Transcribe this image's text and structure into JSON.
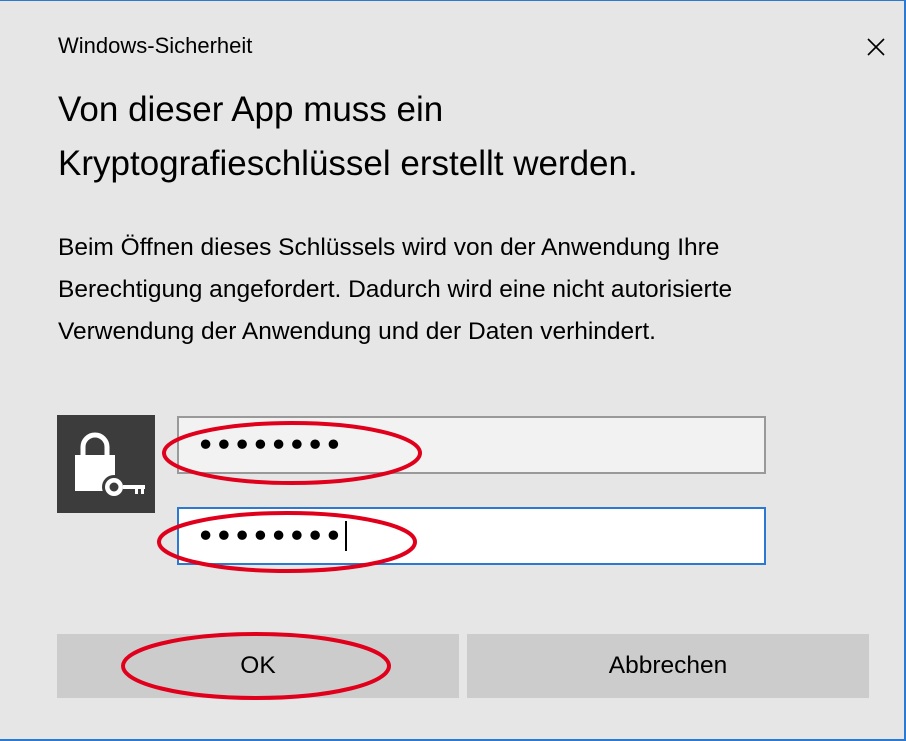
{
  "dialog": {
    "title": "Windows-Sicherheit",
    "close_icon": "close-icon",
    "heading_line1": "Von dieser App muss ein",
    "heading_line2": "Kryptografieschlüssel erstellt werden.",
    "description": "Beim Öffnen dieses Schlüssels wird von der Anwendung Ihre Berechtigung angefordert. Dadurch wird eine nicht autorisierte Verwendung der Anwendung und der Daten verhindert.",
    "key_icon": "lock-key-icon",
    "password_field": "••••••••",
    "confirm_password_field": "••••••••",
    "ok_label": "OK",
    "cancel_label": "Abbrechen"
  },
  "colors": {
    "dialog_background": "#e6e6e6",
    "accent_border": "#2b79d0",
    "button_background": "#cccccc",
    "icon_tile": "#3c3c3c",
    "highlight_ellipse": "#e0001b"
  },
  "annotations": {
    "highlight_markers": [
      "password-field",
      "confirm-password-field",
      "ok-button"
    ]
  }
}
